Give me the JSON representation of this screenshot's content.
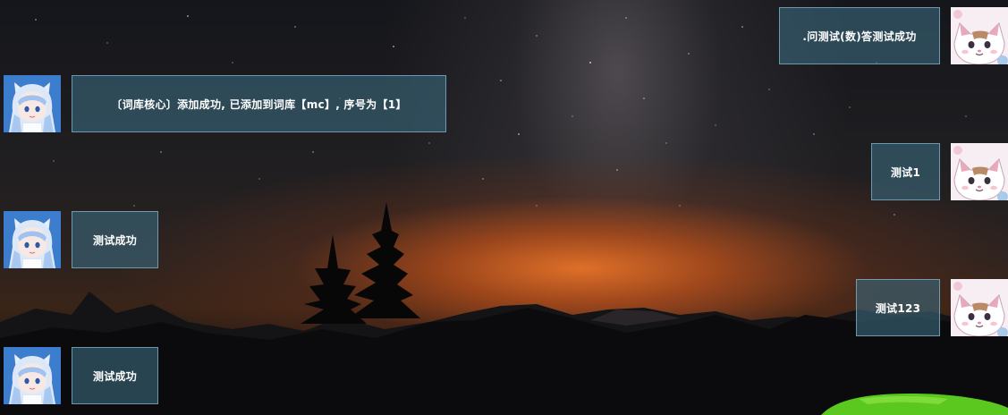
{
  "messages": [
    {
      "side": "right",
      "sender": "user",
      "text": ".问测试(数)答测试成功"
    },
    {
      "side": "left",
      "sender": "bot",
      "text": "〔词库核心〕添加成功, 已添加到词库【mc】, 序号为【1】"
    },
    {
      "side": "right",
      "sender": "user",
      "text": "测试1"
    },
    {
      "side": "left",
      "sender": "bot",
      "text": "测试成功"
    },
    {
      "side": "right",
      "sender": "user",
      "text": "测试123"
    },
    {
      "side": "left",
      "sender": "bot",
      "text": "测试成功"
    }
  ],
  "avatars": {
    "bot": "anime-girl-avatar",
    "user": "cat-avatar"
  },
  "background": "night-sky-milky-way-tent",
  "colors": {
    "bubble_fill": "#3a687a",
    "bubble_border": "#82b4cd",
    "bubble_text": "#ffffff",
    "horizon_glow": "#e87328",
    "tent_green": "#5ac81e"
  }
}
